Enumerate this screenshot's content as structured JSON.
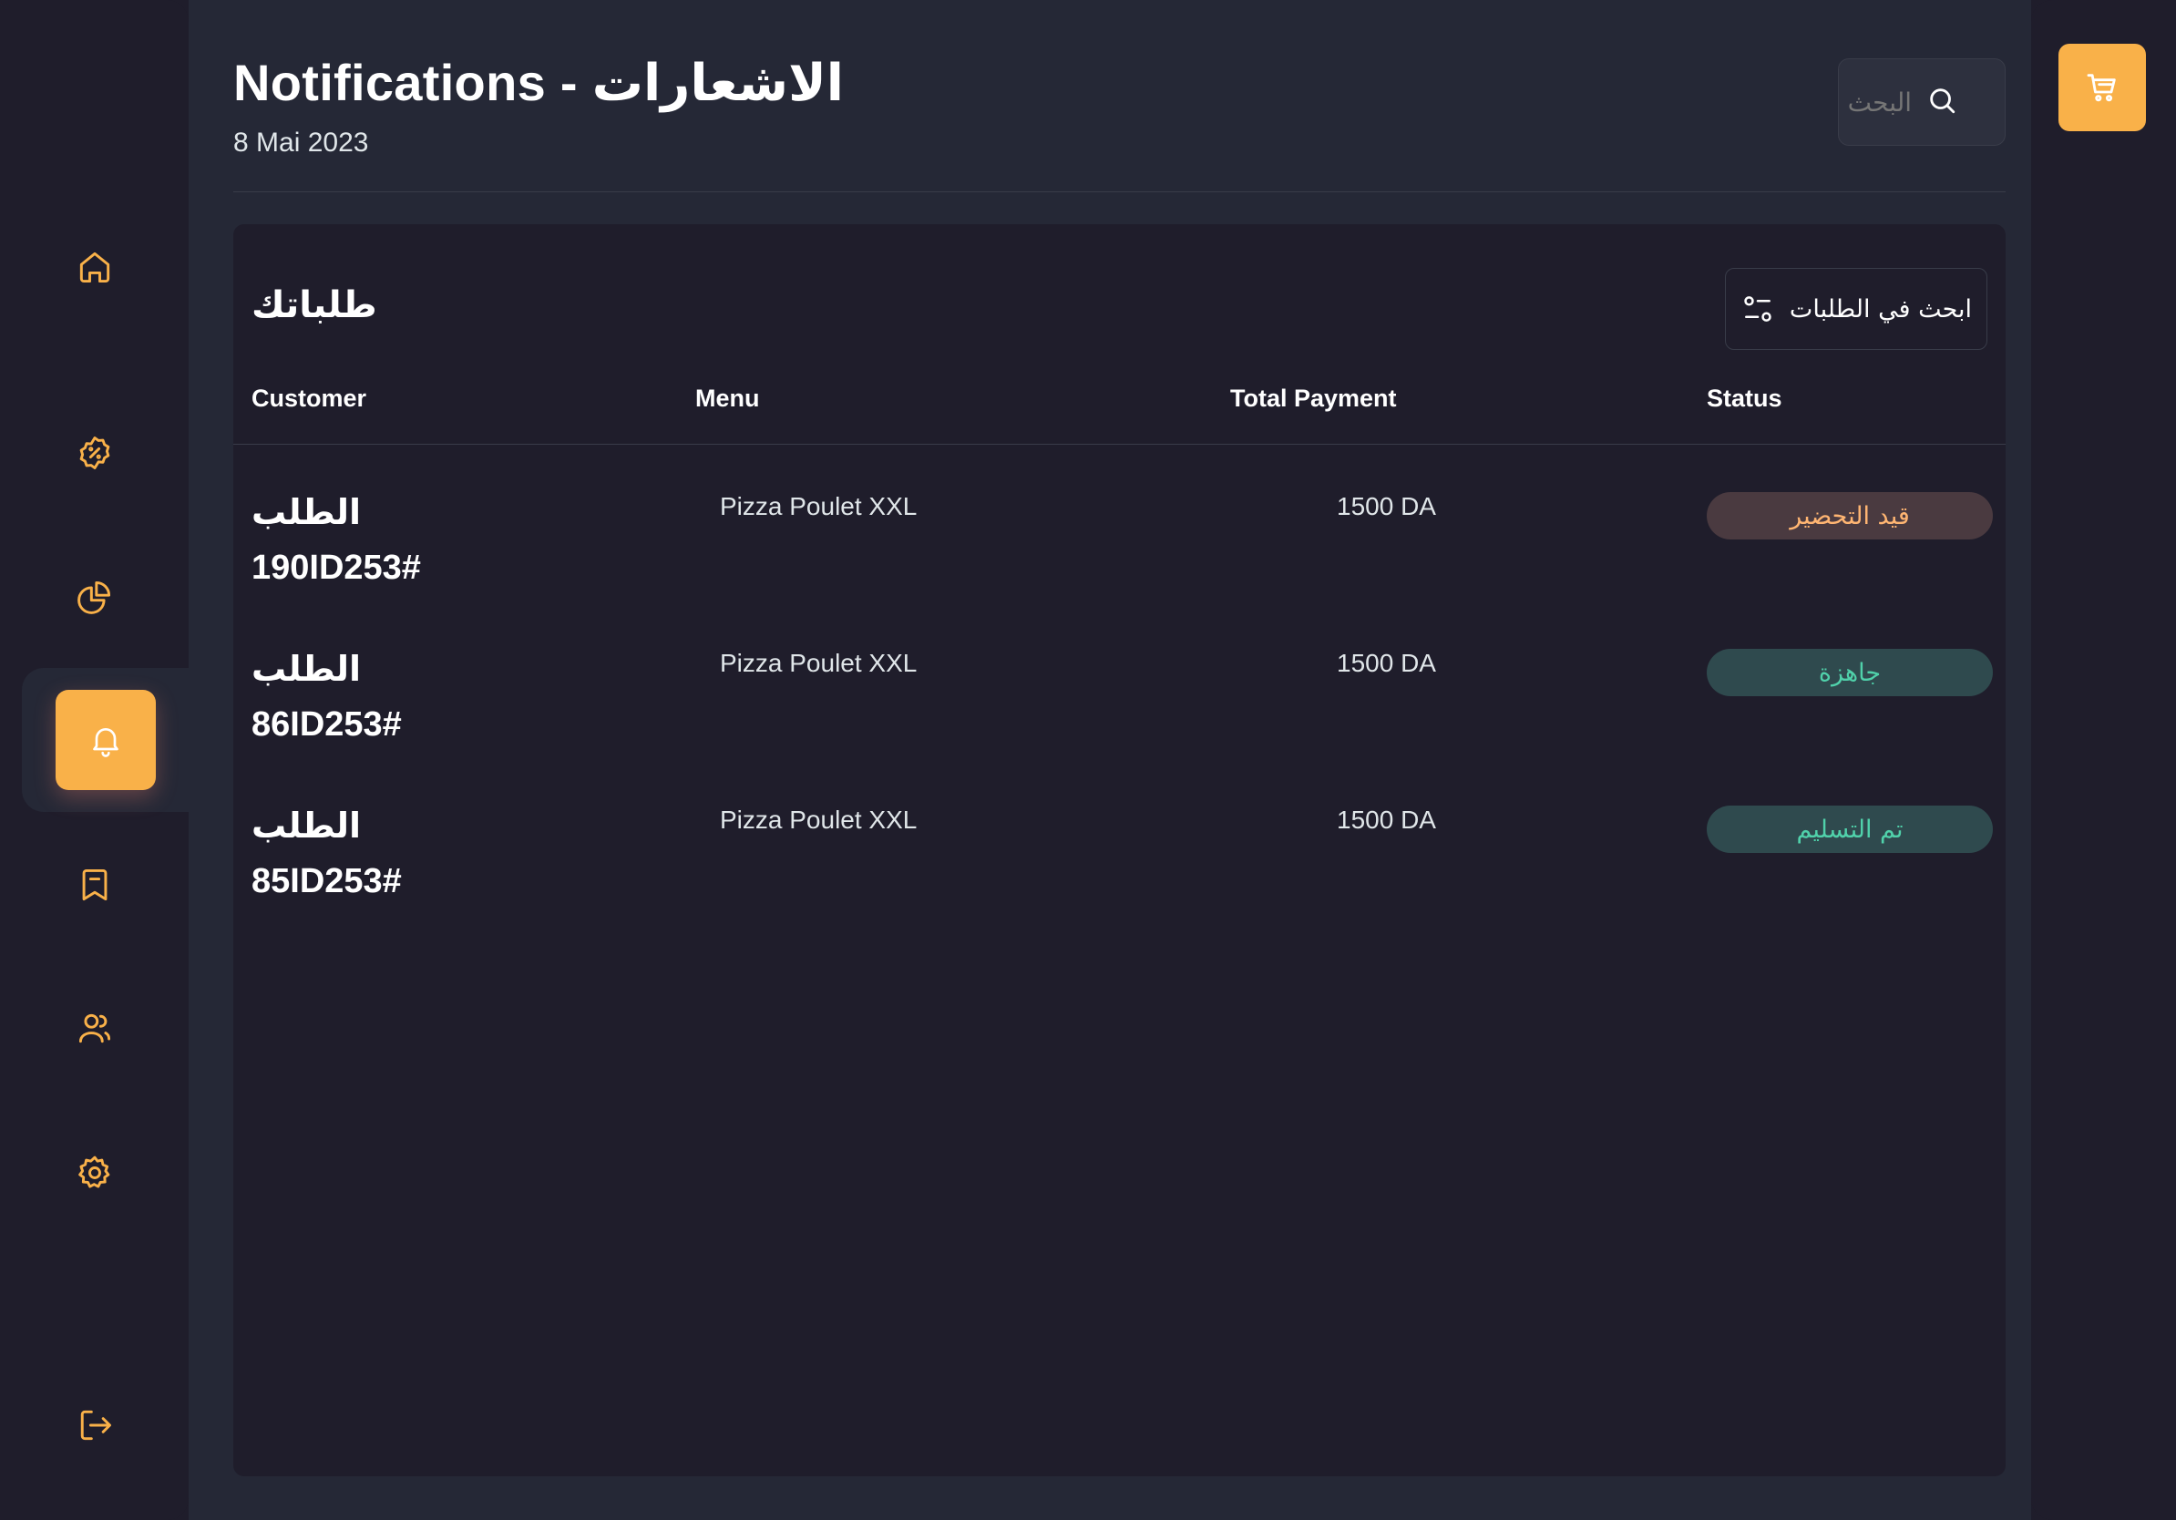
{
  "header": {
    "title": "Notifications - الاشعارات",
    "date": "8 Mai 2023",
    "search_placeholder": "البحث"
  },
  "sidebar": {
    "items": [
      {
        "icon": "home-icon"
      },
      {
        "icon": "discount-icon"
      },
      {
        "icon": "pie-chart-icon"
      },
      {
        "icon": "bell-icon",
        "active": true
      },
      {
        "icon": "bookmark-icon"
      },
      {
        "icon": "users-icon"
      },
      {
        "icon": "gear-icon"
      },
      {
        "icon": "logout-icon"
      }
    ]
  },
  "orders": {
    "title": "طلباتك",
    "filter_label": "ابحث في الطلبات",
    "columns": [
      "Customer",
      "Menu",
      "Total Payment",
      "Status"
    ],
    "rows": [
      {
        "label": "الطلب",
        "id": "190ID253#",
        "menu": "Pizza Poulet XXL",
        "payment": "1500 DA",
        "status": "قيد التحضير"
      },
      {
        "label": "الطلب",
        "id": "86ID253#",
        "menu": "Pizza Poulet XXL",
        "payment": "1500 DA",
        "status": "جاهزة"
      },
      {
        "label": "الطلب",
        "id": "85ID253#",
        "menu": "Pizza Poulet XXL",
        "payment": "1500 DA",
        "status": "تم التسليم"
      }
    ]
  },
  "right_bar": {
    "cart_icon": "cart-icon"
  },
  "colors": {
    "accent": "#f9b149",
    "background": "#1f1d2b",
    "surface": "#252836",
    "status_preparing": "#ffb572",
    "status_ready": "#50d1aa"
  }
}
